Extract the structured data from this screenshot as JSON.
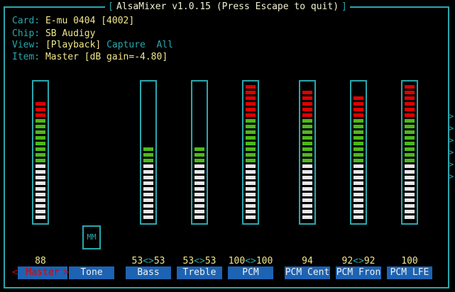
{
  "window": {
    "title": "AlsaMixer v1.0.15 (Press Escape to quit)"
  },
  "info": {
    "card_label": "Card:",
    "card_value": "E-mu 0404 [4002]",
    "chip_label": "Chip:",
    "chip_value": "SB Audigy",
    "view_label": "View:",
    "view_playback": "[Playback]",
    "view_capture": "Capture",
    "view_all": "All",
    "item_label": "Item:",
    "item_value": "Master [dB gain=-4.80]"
  },
  "channels": [
    {
      "label": "Master",
      "value_left": "88",
      "value_right": "",
      "level": 88,
      "selected": true
    },
    {
      "label": "Tone",
      "value_left": "",
      "value_right": "",
      "level": 0,
      "badge": "MM"
    },
    {
      "label": "Bass",
      "value_left": "53",
      "value_right": "53",
      "level": 53
    },
    {
      "label": "Treble",
      "value_left": "53",
      "value_right": "53",
      "level": 53
    },
    {
      "label": "PCM",
      "value_left": "100",
      "value_right": "100",
      "level": 100
    },
    {
      "label": "PCM Cent",
      "value_left": "94",
      "value_right": "",
      "level": 94
    },
    {
      "label": "PCM Fron",
      "value_left": "92",
      "value_right": "92",
      "level": 92
    },
    {
      "label": "PCM LFE",
      "value_left": "100",
      "value_right": "",
      "level": 100
    }
  ],
  "selection_markers": {
    "left": "<",
    "right": ">"
  },
  "pair_arrow": "<>",
  "scroll_indicator": ">",
  "colors": {
    "border": "#2aa7ad",
    "red": "#e00000",
    "green": "#4cba1b",
    "white": "#e8e8e8",
    "label_bg": "#1d63b3"
  }
}
